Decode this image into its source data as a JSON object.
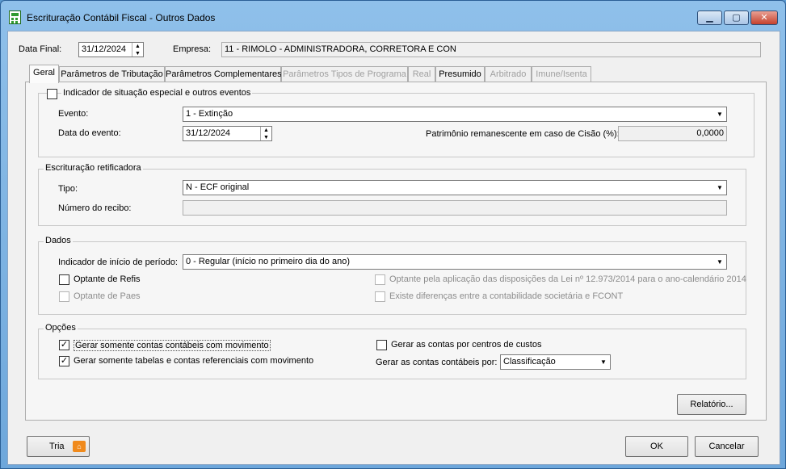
{
  "window": {
    "title": "Escrituração Contábil Fiscal - Outros Dados",
    "minimize_icon": "minimize-icon",
    "maximize_icon": "maximize-icon",
    "close_icon": "close-icon"
  },
  "header": {
    "data_final_label": "Data Final:",
    "data_final_value": "31/12/2024",
    "empresa_label": "Empresa:",
    "empresa_value": "11 - RIMOLO - ADMINISTRADORA, CORRETORA E CON"
  },
  "tabs": [
    {
      "label": "Geral",
      "active": true,
      "enabled": true
    },
    {
      "label": "Parâmetros de Tributação",
      "active": false,
      "enabled": true
    },
    {
      "label": "Parâmetros Complementares",
      "active": false,
      "enabled": true
    },
    {
      "label": "Parâmetros Tipos de Programa",
      "active": false,
      "enabled": false
    },
    {
      "label": "Real",
      "active": false,
      "enabled": false
    },
    {
      "label": "Presumido",
      "active": false,
      "enabled": true
    },
    {
      "label": "Arbitrado",
      "active": false,
      "enabled": false
    },
    {
      "label": "Imune/Isenta",
      "active": false,
      "enabled": false
    }
  ],
  "situacao": {
    "checkbox_label": "Indicador de situação especial e outros eventos",
    "checked": false,
    "evento_label": "Evento:",
    "evento_value": "1 - Extinção",
    "data_evento_label": "Data do evento:",
    "data_evento_value": "31/12/2024",
    "patrimonio_label": "Patrimônio remanescente em caso de Cisão (%):",
    "patrimonio_value": "0,0000"
  },
  "retificadora": {
    "title": "Escrituração retificadora",
    "tipo_label": "Tipo:",
    "tipo_value": "N - ECF original",
    "recibo_label": "Número do recibo:",
    "recibo_value": ""
  },
  "dados": {
    "title": "Dados",
    "inicio_label": "Indicador de início de período:",
    "inicio_value": "0 - Regular (início no primeiro dia do ano)",
    "refis_label": "Optante de Refis",
    "paes_label": "Optante de Paes",
    "lei_label": "Optante pela aplicação das disposições da Lei nº 12.973/2014 para o ano-calendário 2014",
    "diferencas_label": "Existe diferenças entre a contabilidade societária e FCONT"
  },
  "opcoes": {
    "title": "Opções",
    "contas_mov_label": "Gerar somente contas contábeis com movimento",
    "contas_mov_checked": true,
    "tabelas_label": "Gerar somente tabelas e contas referenciais com movimento",
    "tabelas_checked": true,
    "centros_label": "Gerar as contas por centros de custos",
    "centros_checked": false,
    "gerar_por_label": "Gerar as contas contábeis por:",
    "gerar_por_value": "Classificação"
  },
  "buttons": {
    "relatorio": "Relatório...",
    "tria": "Tria",
    "ok": "OK",
    "cancelar": "Cancelar"
  },
  "colors": {
    "titlebar": "#8fc0ea",
    "close": "#c5412d",
    "tria_icon": "#f08a1c"
  }
}
